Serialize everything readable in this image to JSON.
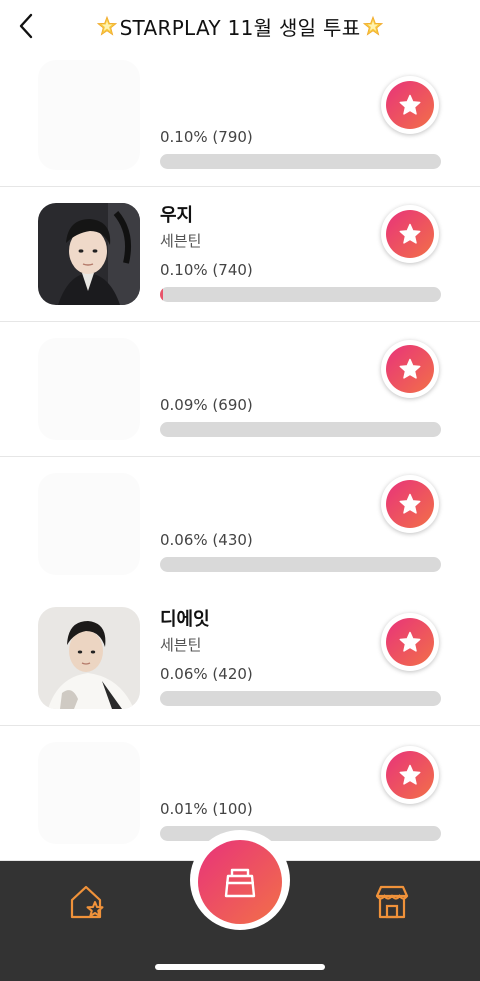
{
  "header": {
    "title": "STARPLAY 11월 생일 투표"
  },
  "rows": [
    {
      "name": "",
      "group": "",
      "percent_text": "0.10% (790)",
      "progress": 0.0,
      "avatar": "blank"
    },
    {
      "name": "우지",
      "group": "세븐틴",
      "percent_text": "0.10% (740)",
      "progress": 0.001,
      "avatar": "photo"
    },
    {
      "name": "",
      "group": "",
      "percent_text": "0.09% (690)",
      "progress": 0.0,
      "avatar": "blank"
    },
    {
      "name": "",
      "group": "",
      "percent_text": "0.06% (430)",
      "progress": 0.0,
      "avatar": "blank"
    },
    {
      "name": "디에잇",
      "group": "세븐틴",
      "percent_text": "0.06% (420)",
      "progress": 0.0,
      "avatar": "photo"
    },
    {
      "name": "",
      "group": "",
      "percent_text": "0.01% (100)",
      "progress": 0.0,
      "avatar": "blank"
    }
  ],
  "icons": {
    "back": "chevron-left-icon",
    "vote": "star-icon",
    "home": "home-star-icon",
    "vote_box": "ballot-box-icon",
    "store": "store-icon"
  },
  "colors": {
    "accent_start": "#e8337a",
    "accent_end": "#f27048",
    "nav_icon": "#f0923a",
    "bottom_bar": "#333333"
  }
}
